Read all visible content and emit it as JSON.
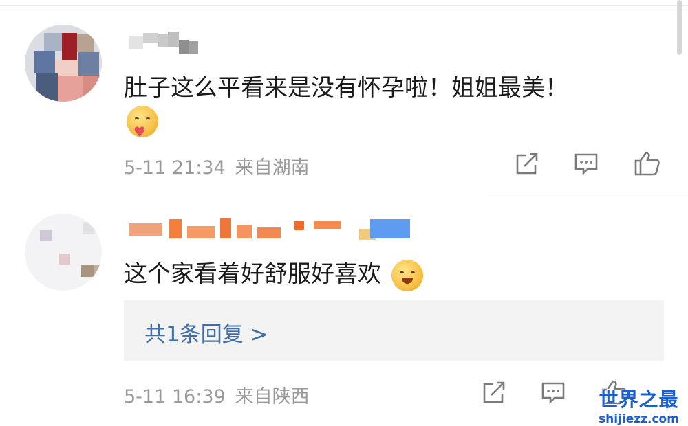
{
  "comments": [
    {
      "content": "肚子这么平看来是没有怀孕啦！姐姐最美！",
      "emoji": "hugging-heart-emoji",
      "date": "5-11 21:34",
      "location": "来自湖南",
      "actions": [
        "share-icon",
        "comment-icon",
        "like-icon"
      ]
    },
    {
      "content": "这个家看着好舒服好喜欢",
      "emoji": "happy-heart-emoji",
      "reply_link": "共1条回复 >",
      "date": "5-11 16:39",
      "location": "来自陕西",
      "actions": [
        "share-icon",
        "comment-icon",
        "like-icon"
      ]
    }
  ],
  "watermark": {
    "title": "世界之最",
    "url": "shijiezz.com"
  },
  "colors": {
    "text": "#1a1a1a",
    "meta": "#9a9a9a",
    "link": "#3f6ea8",
    "reply_bg": "#f3f3f3"
  }
}
